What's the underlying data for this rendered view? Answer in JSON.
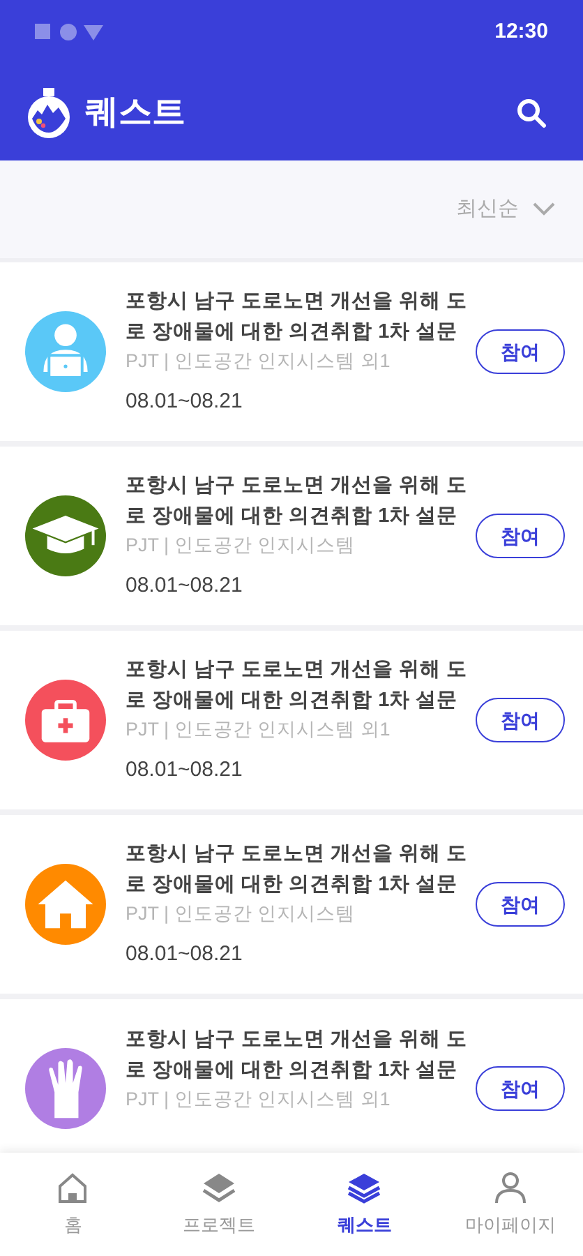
{
  "status_bar": {
    "time": "12:30"
  },
  "app_bar": {
    "title": "퀘스트"
  },
  "sort": {
    "label": "최신순"
  },
  "quests": [
    {
      "kind": "laptop",
      "color": "#5ac8f7",
      "title_lines": [
        "포항시 남구 도로노면 개선을 위해 도",
        "로 장애물에 대한 의견취합 1차 설문"
      ],
      "project": "PJT | 인도공간 인지시스템 외1",
      "dates": "08.01~08.21",
      "button": "참여"
    },
    {
      "kind": "cap",
      "color": "#4a7a14",
      "title_lines": [
        "포항시 남구 도로노면 개선을 위해 도",
        "로 장애물에 대한 의견취합 1차 설문"
      ],
      "project": "PJT | 인도공간 인지시스템",
      "dates": "08.01~08.21",
      "button": "참여"
    },
    {
      "kind": "kit",
      "color": "#f4505c",
      "title_lines": [
        "포항시 남구 도로노면 개선을 위해 도",
        "로 장애물에 대한 의견취합 1차 설문"
      ],
      "project": "PJT | 인도공간 인지시스템 외1",
      "dates": "08.01~08.21",
      "button": "참여"
    },
    {
      "kind": "house",
      "color": "#ff8a00",
      "title_lines": [
        "포항시 남구 도로노면 개선을 위해 도",
        "로 장애물에 대한 의견취합 1차 설문"
      ],
      "project": "PJT | 인도공간 인지시스템",
      "dates": "08.01~08.21",
      "button": "참여"
    },
    {
      "kind": "hand",
      "color": "#b07ee3",
      "title_lines": [
        "포항시 남구 도로노면 개선을 위해 도",
        "로 장애물에 대한 의견취합 1차 설문"
      ],
      "project": "PJT | 인도공간 인지시스템 외1",
      "button": "참여"
    }
  ],
  "bottom_nav": [
    {
      "kind": "home",
      "label": "홈",
      "selected": false
    },
    {
      "kind": "layers",
      "label": "프로젝트",
      "selected": false
    },
    {
      "kind": "layers",
      "label": "퀘스트",
      "selected": true
    },
    {
      "kind": "person",
      "label": "마이페이지",
      "selected": false
    }
  ]
}
